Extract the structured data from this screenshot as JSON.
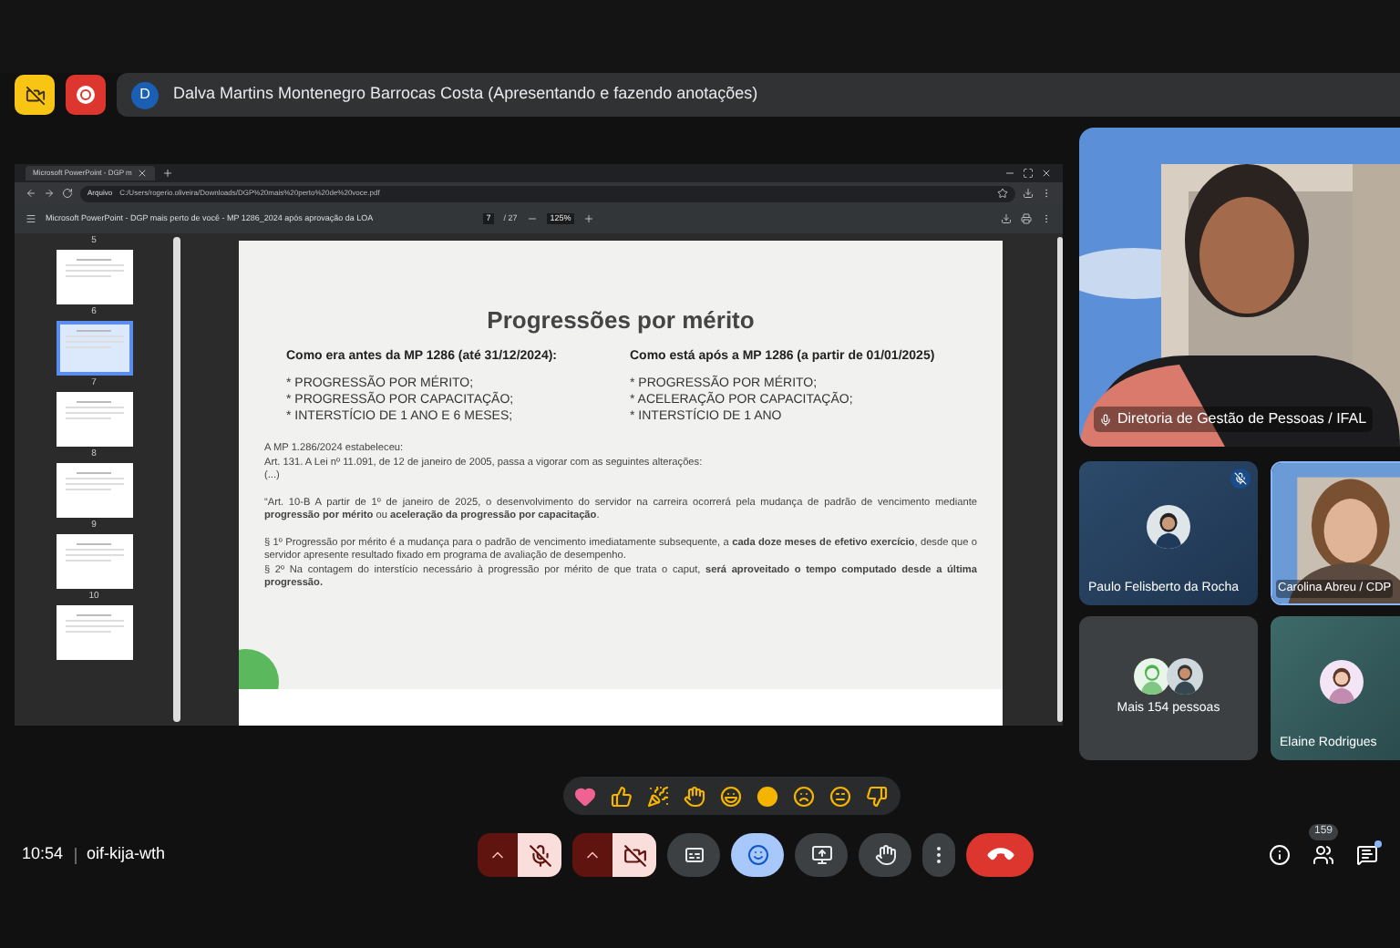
{
  "top_bar": {
    "presenter_initial": "D",
    "presenter_label": "Dalva Martins Montenegro Barrocas Costa (Apresentando e fazendo anotações)"
  },
  "shared_screen": {
    "browser_tab": "Microsoft PowerPoint - DGP m",
    "address_chip": "Arquivo",
    "url": "C:/Users/rogerio.oliveira/Downloads/DGP%20mais%20perto%20de%20voce.pdf",
    "pdf_title": "Microsoft PowerPoint - DGP mais perto de você - MP 1286_2024 após aprovação da LOA",
    "page": "7",
    "page_total": "/ 27",
    "zoom": "125%",
    "thumbnails": [
      {
        "label": "5",
        "selected": false
      },
      {
        "label": "6",
        "selected": true
      },
      {
        "label": "7",
        "selected": false
      },
      {
        "label": "8",
        "selected": false
      },
      {
        "label": "9",
        "selected": false
      },
      {
        "label": "10",
        "selected": false
      }
    ],
    "slide": {
      "title": "Progressões por mérito",
      "columns": [
        {
          "heading": "Como era antes da MP 1286 (até 31/12/2024):",
          "items": [
            "* PROGRESSÃO POR MÉRITO;",
            "* PROGRESSÃO POR CAPACITAÇÃO;",
            "* INTERSTÍCIO DE 1 ANO E 6 MESES;"
          ]
        },
        {
          "heading": "Como está após a MP 1286 (a partir de 01/01/2025)",
          "items": [
            "* PROGRESSÃO POR MÉRITO;",
            "* ACELERAÇÃO POR CAPACITAÇÃO;",
            "* INTERSTÍCIO DE 1 ANO"
          ]
        }
      ],
      "blocks": [
        [
          "A MP 1.286/2024 estabeleceu:",
          "Art. 131. A Lei nº 11.091, de 12 de janeiro de 2005, passa a vigorar com as seguintes alterações:",
          "(...)"
        ],
        [
          "“Art. 10-B A partir de 1º de janeiro de 2025, o desenvolvimento do servidor na carreira ocorrerá pela mudança de padrão de vencimento mediante **progressão por mérito** ou **aceleração da progressão por capacitação**."
        ],
        [
          "§ 1º Progressão por mérito é a mudança para o padrão de vencimento imediatamente subsequente, a **cada doze meses de efetivo exercício**, desde que o servidor apresente resultado fixado em programa de avaliação de desempenho.",
          "§ 2º Na contagem do interstício necessário à progressão por mérito de que trata o caput, **será aproveitado o tempo computado desde a última progressão.**"
        ]
      ]
    }
  },
  "participants": {
    "main_caption": "Diretoria de Gestão de Pessoas / IFAL",
    "tiles": [
      {
        "kind": "avatar",
        "name": "Paulo Felisberto da Rocha",
        "muted": true
      },
      {
        "kind": "video",
        "name": "Carolina Abreu / CDP",
        "muted": false
      },
      {
        "kind": "more",
        "name": "Mais 154 pessoas",
        "muted": false
      },
      {
        "kind": "avatar",
        "name": "Elaine Rodrigues",
        "muted": false
      }
    ]
  },
  "reactions": [
    {
      "kind": "heart"
    },
    {
      "kind": "thumbs_up"
    },
    {
      "kind": "party"
    },
    {
      "kind": "clap"
    },
    {
      "kind": "laugh"
    },
    {
      "kind": "surprised"
    },
    {
      "kind": "sad"
    },
    {
      "kind": "thinking"
    },
    {
      "kind": "thumbs_down"
    }
  ],
  "bottom_bar": {
    "time": "10:54",
    "meeting_code": "oif-kija-wth",
    "controls": [
      {
        "kind": "mic",
        "on": false
      },
      {
        "kind": "camera",
        "on": false
      },
      {
        "kind": "captions",
        "selected": false
      },
      {
        "kind": "reactions",
        "selected": true
      },
      {
        "kind": "present",
        "selected": false
      },
      {
        "kind": "hand",
        "selected": false
      },
      {
        "kind": "more",
        "selected": false
      },
      {
        "kind": "end_call",
        "selected": false
      }
    ],
    "people_count": "159"
  }
}
